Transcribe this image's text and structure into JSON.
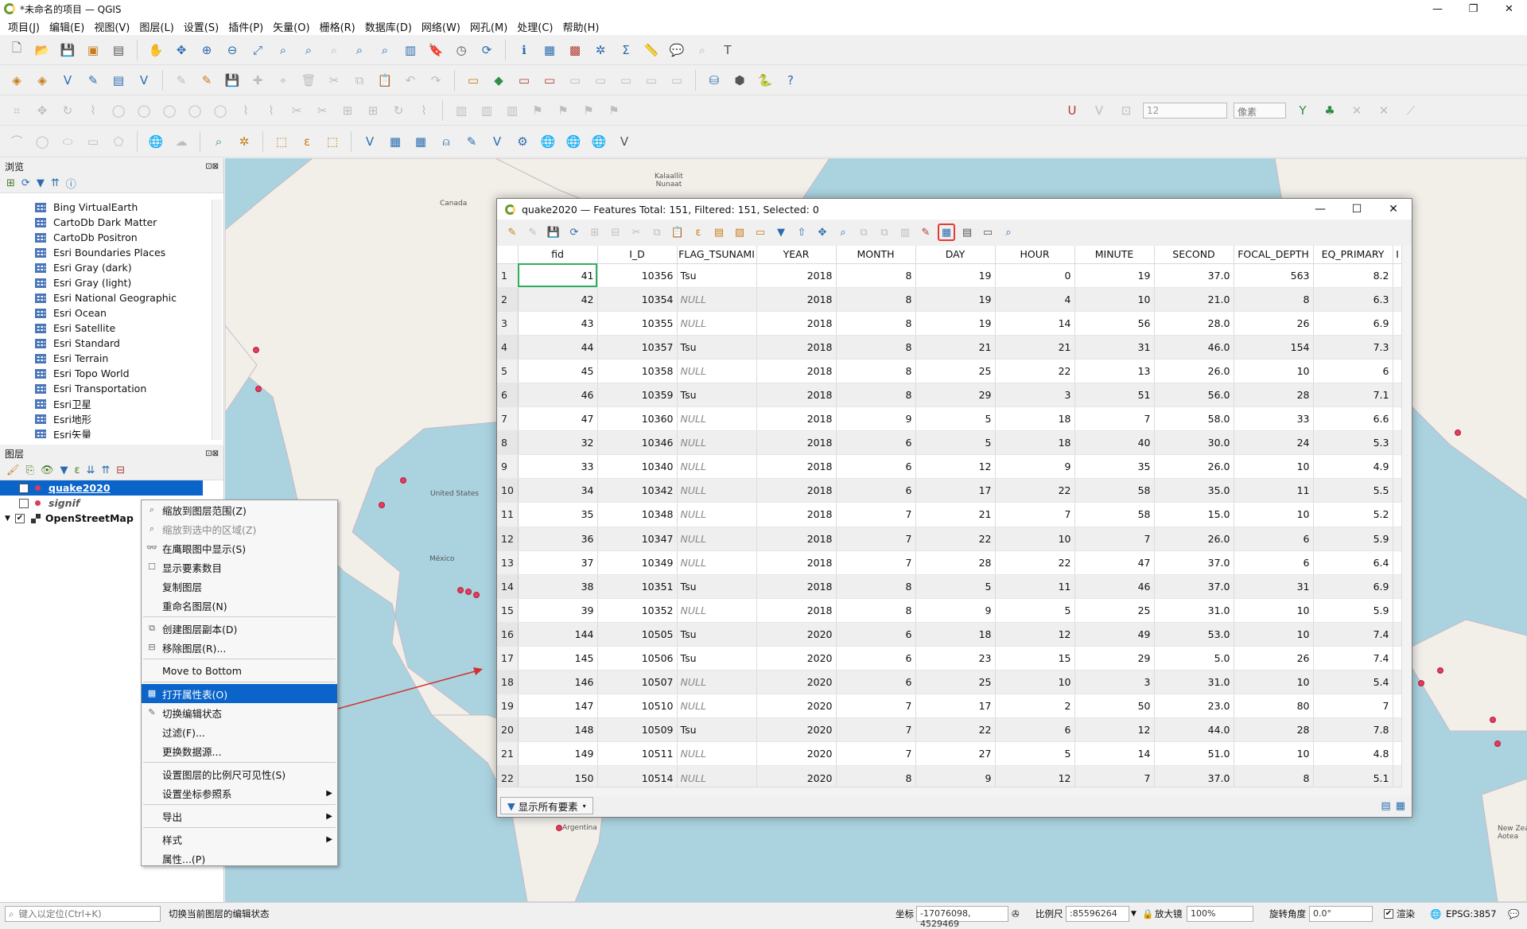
{
  "app": {
    "title": "*未命名的项目 — QGIS",
    "win_controls": [
      "—",
      "❐",
      "✕"
    ]
  },
  "menu": [
    "项目(J)",
    "编辑(E)",
    "视图(V)",
    "图层(L)",
    "设置(S)",
    "插件(P)",
    "矢量(O)",
    "栅格(R)",
    "数据库(D)",
    "网络(W)",
    "网孔(M)",
    "处理(C)",
    "帮助(H)"
  ],
  "snapping": {
    "tolerance": "12",
    "unit": "像素"
  },
  "browser": {
    "title": "浏览",
    "items": [
      "Bing VirtualEarth",
      "CartoDb Dark Matter",
      "CartoDb Positron",
      "Esri Boundaries Places",
      "Esri Gray (dark)",
      "Esri Gray (light)",
      "Esri National Geographic",
      "Esri Ocean",
      "Esri Satellite",
      "Esri Standard",
      "Esri Terrain",
      "Esri Topo World",
      "Esri Transportation",
      "Esri卫星",
      "Esri地形",
      "Esri矢量"
    ]
  },
  "layers": {
    "title": "图层",
    "items": [
      {
        "name": "quake2020",
        "checked": true
      },
      {
        "name": "signif",
        "checked": false
      },
      {
        "name": "OpenStreetMap",
        "checked": true
      }
    ]
  },
  "context_menu": {
    "items": [
      {
        "label": "缩放到图层范围(Z)",
        "icon": "zoom-layer-icon",
        "disabled": false
      },
      {
        "label": "缩放到选中的区域(Z)",
        "icon": "zoom-selection-icon",
        "disabled": true
      },
      {
        "label": "在鹰眼图中显示(S)",
        "icon": "overview-icon",
        "disabled": false
      },
      {
        "label": "显示要素数目",
        "icon": "checkbox-icon",
        "disabled": false
      },
      {
        "label": "复制图层",
        "icon": "",
        "disabled": false
      },
      {
        "label": "重命名图层(N)",
        "icon": "",
        "disabled": false
      },
      {
        "sep": true
      },
      {
        "label": "创建图层副本(D)",
        "icon": "duplicate-icon",
        "disabled": false
      },
      {
        "label": "移除图层(R)...",
        "icon": "remove-icon",
        "disabled": false
      },
      {
        "sep": true
      },
      {
        "label": "Move to Bottom",
        "icon": "",
        "disabled": false
      },
      {
        "sep": true
      },
      {
        "label": "打开属性表(O)",
        "icon": "table-icon",
        "disabled": false,
        "selected": true
      },
      {
        "label": "切换编辑状态",
        "icon": "pencil-icon",
        "disabled": false
      },
      {
        "label": "过滤(F)...",
        "icon": "",
        "disabled": false
      },
      {
        "label": "更换数据源...",
        "icon": "",
        "disabled": false
      },
      {
        "sep": true
      },
      {
        "label": "设置图层的比例尺可见性(S)",
        "icon": "",
        "disabled": false
      },
      {
        "label": "设置坐标参照系",
        "icon": "",
        "disabled": false,
        "submenu": true
      },
      {
        "sep": true
      },
      {
        "label": "导出",
        "icon": "",
        "disabled": false,
        "submenu": true
      },
      {
        "sep": true
      },
      {
        "label": "样式",
        "icon": "",
        "disabled": false,
        "submenu": true
      },
      {
        "label": "属性...(P)",
        "icon": "",
        "disabled": false
      }
    ]
  },
  "map_labels": [
    {
      "text": "Kalaallit\nNunaat",
      "id": "greenland"
    },
    {
      "text": "Canada",
      "id": "canada"
    },
    {
      "text": "United States",
      "id": "us"
    },
    {
      "text": "México",
      "id": "mexico"
    },
    {
      "text": "Argentina",
      "id": "argentina"
    },
    {
      "text": "New Zea\nAotea",
      "id": "nz"
    }
  ],
  "attr_table": {
    "title": "quake2020 — Features Total: 151, Filtered: 151, Selected: 0",
    "columns": [
      "fid",
      "I_D",
      "FLAG_TSUNAMI",
      "YEAR",
      "MONTH",
      "DAY",
      "HOUR",
      "MINUTE",
      "SECOND",
      "FOCAL_DEPTH",
      "EQ_PRIMARY",
      "I"
    ],
    "rows": [
      [
        "1",
        "41",
        "10356",
        "Tsu",
        "2018",
        "8",
        "19",
        "0",
        "19",
        "37.0",
        "563",
        "8.2"
      ],
      [
        "2",
        "42",
        "10354",
        "NULL",
        "2018",
        "8",
        "19",
        "4",
        "10",
        "21.0",
        "8",
        "6.3"
      ],
      [
        "3",
        "43",
        "10355",
        "NULL",
        "2018",
        "8",
        "19",
        "14",
        "56",
        "28.0",
        "26",
        "6.9"
      ],
      [
        "4",
        "44",
        "10357",
        "Tsu",
        "2018",
        "8",
        "21",
        "21",
        "31",
        "46.0",
        "154",
        "7.3"
      ],
      [
        "5",
        "45",
        "10358",
        "NULL",
        "2018",
        "8",
        "25",
        "22",
        "13",
        "26.0",
        "10",
        "6"
      ],
      [
        "6",
        "46",
        "10359",
        "Tsu",
        "2018",
        "8",
        "29",
        "3",
        "51",
        "56.0",
        "28",
        "7.1"
      ],
      [
        "7",
        "47",
        "10360",
        "NULL",
        "2018",
        "9",
        "5",
        "18",
        "7",
        "58.0",
        "33",
        "6.6"
      ],
      [
        "8",
        "32",
        "10346",
        "NULL",
        "2018",
        "6",
        "5",
        "18",
        "40",
        "30.0",
        "24",
        "5.3"
      ],
      [
        "9",
        "33",
        "10340",
        "NULL",
        "2018",
        "6",
        "12",
        "9",
        "35",
        "26.0",
        "10",
        "4.9"
      ],
      [
        "10",
        "34",
        "10342",
        "NULL",
        "2018",
        "6",
        "17",
        "22",
        "58",
        "35.0",
        "11",
        "5.5"
      ],
      [
        "11",
        "35",
        "10348",
        "NULL",
        "2018",
        "7",
        "21",
        "7",
        "58",
        "15.0",
        "10",
        "5.2"
      ],
      [
        "12",
        "36",
        "10347",
        "NULL",
        "2018",
        "7",
        "22",
        "10",
        "7",
        "26.0",
        "6",
        "5.9"
      ],
      [
        "13",
        "37",
        "10349",
        "NULL",
        "2018",
        "7",
        "28",
        "22",
        "47",
        "37.0",
        "6",
        "6.4"
      ],
      [
        "14",
        "38",
        "10351",
        "Tsu",
        "2018",
        "8",
        "5",
        "11",
        "46",
        "37.0",
        "31",
        "6.9"
      ],
      [
        "15",
        "39",
        "10352",
        "NULL",
        "2018",
        "8",
        "9",
        "5",
        "25",
        "31.0",
        "10",
        "5.9"
      ],
      [
        "16",
        "144",
        "10505",
        "Tsu",
        "2020",
        "6",
        "18",
        "12",
        "49",
        "53.0",
        "10",
        "7.4"
      ],
      [
        "17",
        "145",
        "10506",
        "Tsu",
        "2020",
        "6",
        "23",
        "15",
        "29",
        "5.0",
        "26",
        "7.4"
      ],
      [
        "18",
        "146",
        "10507",
        "NULL",
        "2020",
        "6",
        "25",
        "10",
        "3",
        "31.0",
        "10",
        "5.4"
      ],
      [
        "19",
        "147",
        "10510",
        "NULL",
        "2020",
        "7",
        "17",
        "2",
        "50",
        "23.0",
        "80",
        "7"
      ],
      [
        "20",
        "148",
        "10509",
        "Tsu",
        "2020",
        "7",
        "22",
        "6",
        "12",
        "44.0",
        "28",
        "7.8"
      ],
      [
        "21",
        "149",
        "10511",
        "NULL",
        "2020",
        "7",
        "27",
        "5",
        "14",
        "51.0",
        "10",
        "4.8"
      ],
      [
        "22",
        "150",
        "10514",
        "NULL",
        "2020",
        "8",
        "9",
        "12",
        "7",
        "37.0",
        "8",
        "5.1"
      ]
    ],
    "show_all": "显示所有要素"
  },
  "status": {
    "locator_placeholder": "键入以定位(Ctrl+K)",
    "hint": "切换当前图层的编辑状态",
    "coord_label": "坐标",
    "coord": "-17076098, 4529469",
    "scale_label": "比例尺",
    "scale": ":85596264",
    "mag_label": "放大镜",
    "mag": "100%",
    "rot_label": "旋转角度",
    "rot": "0.0°",
    "render_label": "渲染",
    "crs": "EPSG:3857"
  }
}
